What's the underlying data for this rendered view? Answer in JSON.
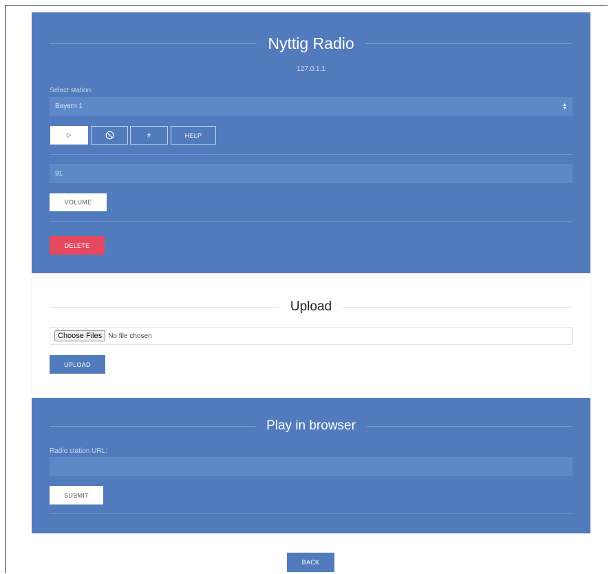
{
  "header": {
    "title": "Nyttig Radio",
    "host": "127.0.1.1"
  },
  "station": {
    "label": "Select station:",
    "selected": "Bayern 1"
  },
  "controls": {
    "play_icon": "play-icon",
    "stop_icon": "stop-icon",
    "hash_label": "#",
    "help_label": "HELP"
  },
  "volume": {
    "value": "91",
    "button_label": "VOLUME"
  },
  "delete": {
    "label": "DELETE"
  },
  "upload": {
    "title": "Upload",
    "choose_label": "Choose Files",
    "no_file_text": "No file chosen",
    "button_label": "UPLOAD"
  },
  "browser": {
    "title": "Play in browser",
    "url_label": "Radio station URL:",
    "url_value": "",
    "submit_label": "SUBMIT"
  },
  "nav": {
    "back_label": "BACK"
  },
  "colors": {
    "panel_blue": "#527bbd",
    "delete_red": "#e5495f",
    "field_blue": "#5e89c9"
  }
}
